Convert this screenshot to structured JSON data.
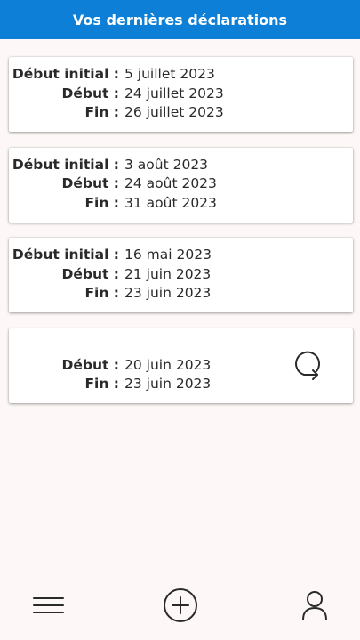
{
  "header": {
    "title": "Vos dernières déclarations"
  },
  "labels": {
    "initial": "Début initial :",
    "start": "Début :",
    "end": "Fin :"
  },
  "declarations": [
    {
      "initial": "5 juillet 2023",
      "start": "24 juillet 2023",
      "end": "26 juillet 2023"
    },
    {
      "initial": "3 août 2023",
      "start": "24 août 2023",
      "end": "31 août 2023"
    },
    {
      "initial": "16 mai 2023",
      "start": "21 juin 2023",
      "end": "23 juin 2023"
    },
    {
      "start": "20 juin 2023",
      "end": "23 juin 2023",
      "action_icon": "refresh-icon"
    }
  ],
  "bottom_nav": {
    "items": [
      {
        "icon": "menu-icon"
      },
      {
        "icon": "add-circle-icon"
      },
      {
        "icon": "user-icon"
      }
    ]
  },
  "colors": {
    "header_bg": "#0e7fd6",
    "header_text": "#ffffff",
    "page_bg": "#fdf8f7",
    "card_bg": "#ffffff",
    "icon": "#2a2a2a"
  }
}
